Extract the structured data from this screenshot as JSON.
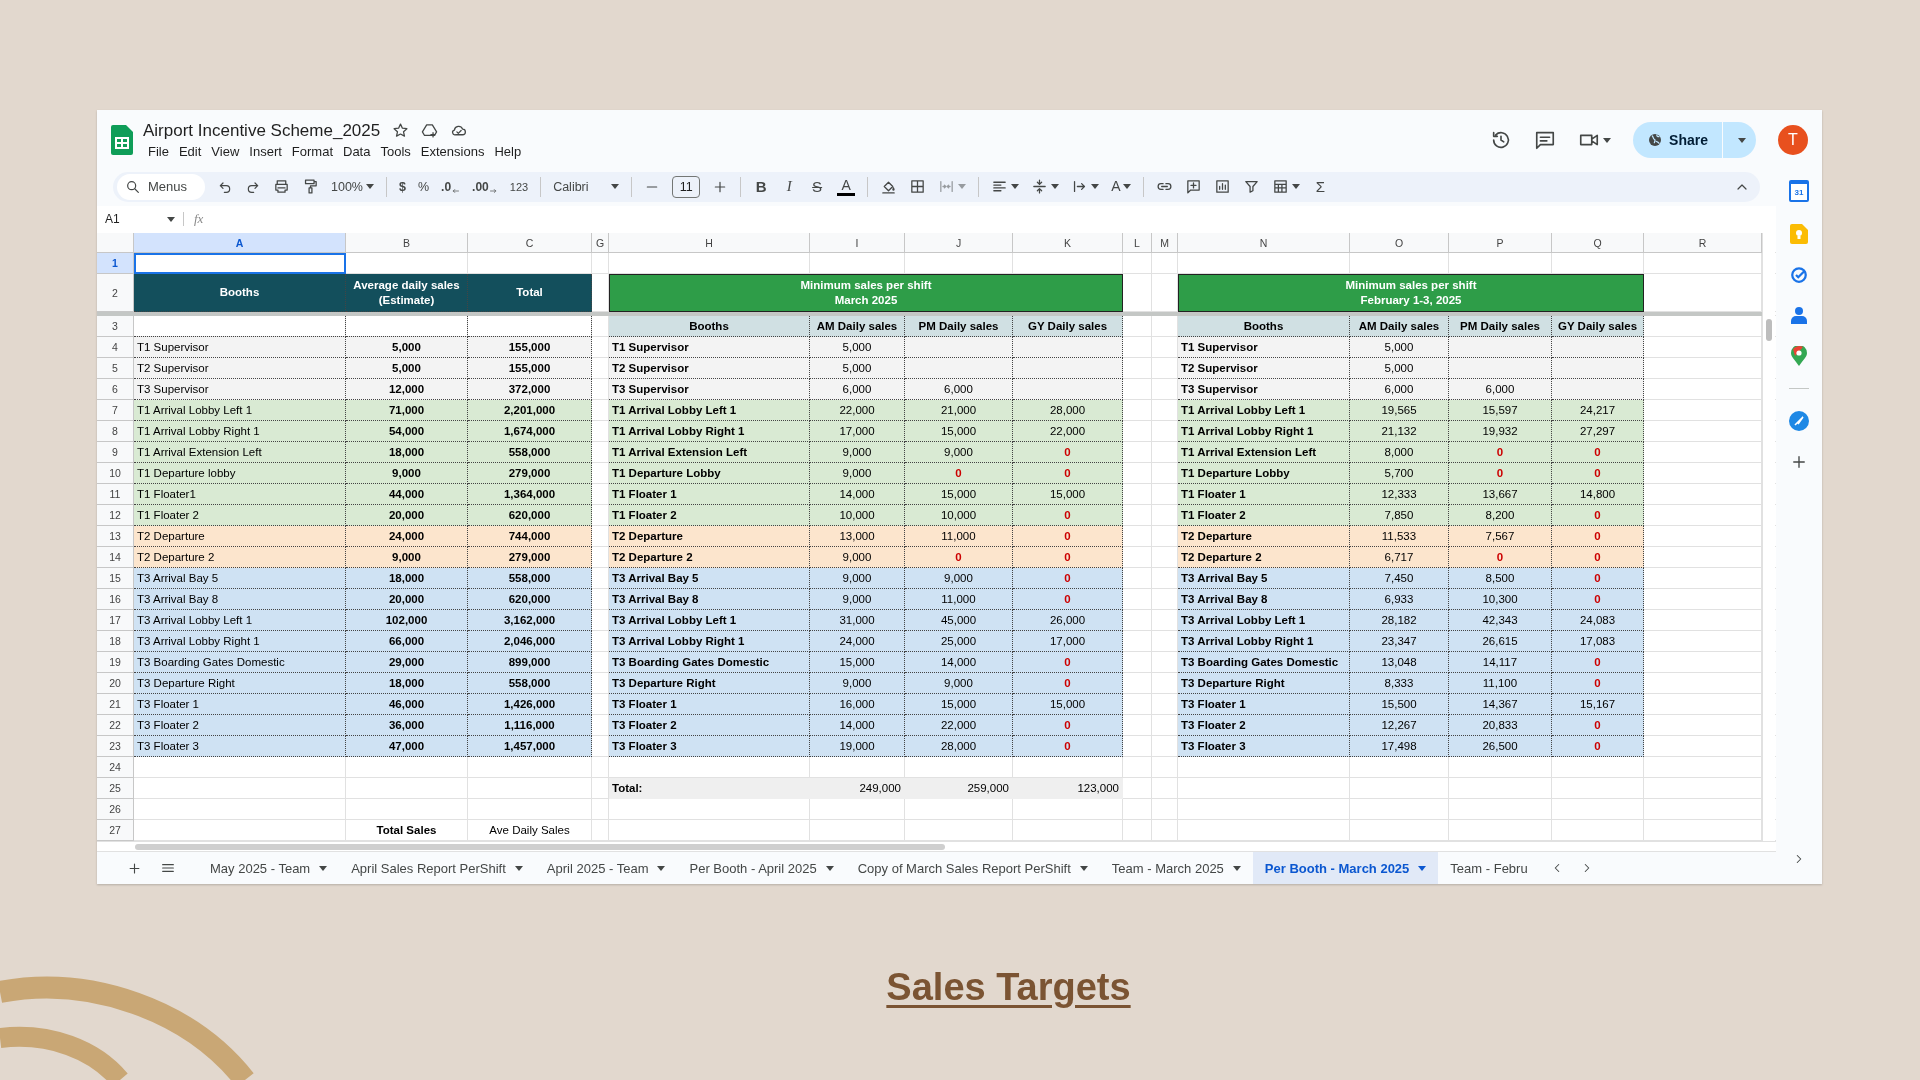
{
  "document": {
    "title": "Airport Incentive Scheme_2025",
    "menus": [
      "File",
      "Edit",
      "View",
      "Insert",
      "Format",
      "Data",
      "Tools",
      "Extensions",
      "Help"
    ],
    "share_label": "Share",
    "avatar_initial": "T"
  },
  "toolbar": {
    "search_placeholder": "Menus",
    "zoom": "100%",
    "currency": "$",
    "percent": "%",
    "decimal_decrease": ".0",
    "decimal_increase": ".00",
    "number_format": "123",
    "font": "Calibri",
    "font_size": "11",
    "bold": "B",
    "italic": "I",
    "strikethrough": "S",
    "text_color": "A",
    "text_rotation": "A",
    "functions": "Σ"
  },
  "formula_bar": {
    "name_box": "A1",
    "formula_label": "fx"
  },
  "side_panel": {
    "calendar_day": "31"
  },
  "sheet": {
    "column_headers": [
      {
        "label": "A",
        "selected": true
      },
      {
        "label": "B",
        "selected": false
      },
      {
        "label": "C",
        "selected": false
      },
      {
        "label": "G",
        "selected": false
      },
      {
        "label": "H",
        "selected": false
      },
      {
        "label": "I",
        "selected": false
      },
      {
        "label": "J",
        "selected": false
      },
      {
        "label": "K",
        "selected": false
      },
      {
        "label": "L",
        "selected": false
      },
      {
        "label": "M",
        "selected": false
      },
      {
        "label": "N",
        "selected": false
      },
      {
        "label": "O",
        "selected": false
      },
      {
        "label": "P",
        "selected": false
      },
      {
        "label": "Q",
        "selected": false
      },
      {
        "label": "R",
        "selected": false
      }
    ],
    "row_numbers": [
      {
        "label": "1",
        "selected": true
      },
      {
        "label": "2",
        "selected": false
      },
      {
        "label": "3",
        "selected": false
      },
      {
        "label": "4",
        "selected": false
      },
      {
        "label": "5",
        "selected": false
      },
      {
        "label": "6",
        "selected": false
      },
      {
        "label": "7",
        "selected": false
      },
      {
        "label": "8",
        "selected": false
      },
      {
        "label": "9",
        "selected": false
      },
      {
        "label": "10",
        "selected": false
      },
      {
        "label": "11",
        "selected": false
      },
      {
        "label": "12",
        "selected": false
      },
      {
        "label": "13",
        "selected": false
      },
      {
        "label": "14",
        "selected": false
      },
      {
        "label": "15",
        "selected": false
      },
      {
        "label": "16",
        "selected": false
      },
      {
        "label": "17",
        "selected": false
      },
      {
        "label": "18",
        "selected": false
      },
      {
        "label": "19",
        "selected": false
      },
      {
        "label": "20",
        "selected": false
      },
      {
        "label": "21",
        "selected": false
      },
      {
        "label": "22",
        "selected": false
      },
      {
        "label": "23",
        "selected": false
      },
      {
        "label": "24",
        "selected": false
      },
      {
        "label": "25",
        "selected": false
      },
      {
        "label": "26",
        "selected": false
      },
      {
        "label": "27",
        "selected": false
      }
    ],
    "booth_table": {
      "headers": [
        [
          "Booths"
        ],
        [
          "Average daily sales",
          "(Estimate)"
        ],
        [
          "Total"
        ]
      ],
      "rows": [
        {
          "booth": "T1 Supervisor",
          "average": "5,000",
          "total": "155,000",
          "color": "#f3f3f3"
        },
        {
          "booth": "T2 Supervisor",
          "average": "5,000",
          "total": "155,000",
          "color": "#f3f3f3"
        },
        {
          "booth": "T3 Supervisor",
          "average": "12,000",
          "total": "372,000",
          "color": "#f3f3f3"
        },
        {
          "booth": "T1 Arrival Lobby Left 1",
          "average": "71,000",
          "total": "2,201,000",
          "color": "#d9ead3"
        },
        {
          "booth": "T1 Arrival Lobby Right 1",
          "average": "54,000",
          "total": "1,674,000",
          "color": "#d9ead3"
        },
        {
          "booth": "T1 Arrival Extension Left",
          "average": "18,000",
          "total": "558,000",
          "color": "#d9ead3"
        },
        {
          "booth": "T1 Departure lobby",
          "average": "9,000",
          "total": "279,000",
          "color": "#d9ead3"
        },
        {
          "booth": "T1 Floater1",
          "average": "44,000",
          "total": "1,364,000",
          "color": "#d9ead3"
        },
        {
          "booth": "T1 Floater 2",
          "average": "20,000",
          "total": "620,000",
          "color": "#d9ead3"
        },
        {
          "booth": "T2 Departure",
          "average": "24,000",
          "total": "744,000",
          "color": "#fce5cd"
        },
        {
          "booth": "T2 Departure 2",
          "average": "9,000",
          "total": "279,000",
          "color": "#fce5cd"
        },
        {
          "booth": "T3 Arrival Bay 5",
          "average": "18,000",
          "total": "558,000",
          "color": "#cfe2f3"
        },
        {
          "booth": "T3 Arrival Bay 8",
          "average": "20,000",
          "total": "620,000",
          "color": "#cfe2f3"
        },
        {
          "booth": "T3 Arrival Lobby Left 1",
          "average": "102,000",
          "total": "3,162,000",
          "color": "#cfe2f3"
        },
        {
          "booth": "T3 Arrival Lobby Right 1",
          "average": "66,000",
          "total": "2,046,000",
          "color": "#cfe2f3"
        },
        {
          "booth": "T3 Boarding Gates Domestic",
          "average": "29,000",
          "total": "899,000",
          "color": "#cfe2f3"
        },
        {
          "booth": "T3 Departure Right",
          "average": "18,000",
          "total": "558,000",
          "color": "#cfe2f3"
        },
        {
          "booth": "T3 Floater 1",
          "average": "46,000",
          "total": "1,426,000",
          "color": "#cfe2f3"
        },
        {
          "booth": "T3 Floater 2",
          "average": "36,000",
          "total": "1,116,000",
          "color": "#cfe2f3"
        },
        {
          "booth": "T3 Floater 3",
          "average": "47,000",
          "total": "1,457,000",
          "color": "#cfe2f3"
        }
      ]
    },
    "shift_tables": [
      {
        "title": [
          "Minimum sales per shift",
          "March 2025"
        ],
        "booth_heading": "Booths",
        "columns": [
          "AM Daily sales",
          "PM Daily sales",
          "GY Daily sales"
        ],
        "rows": [
          {
            "booth": "T1 Supervisor",
            "color": "#f3f3f3",
            "cells": [
              {
                "text": "5,000",
                "flagged": false
              },
              {
                "empty": true
              },
              {
                "empty": true
              }
            ]
          },
          {
            "booth": "T2 Supervisor",
            "color": "#f3f3f3",
            "cells": [
              {
                "text": "5,000",
                "flagged": false
              },
              {
                "empty": true
              },
              {
                "empty": true
              }
            ]
          },
          {
            "booth": "T3 Supervisor",
            "color": "#f3f3f3",
            "cells": [
              {
                "text": "6,000",
                "flagged": false
              },
              {
                "text": "6,000",
                "flagged": false
              },
              {
                "empty": true
              }
            ]
          },
          {
            "booth": "T1 Arrival Lobby Left 1",
            "color": "#d9ead3",
            "cells": [
              {
                "text": "22,000",
                "flagged": false
              },
              {
                "text": "21,000",
                "flagged": false
              },
              {
                "text": "28,000",
                "flagged": false
              }
            ]
          },
          {
            "booth": "T1 Arrival Lobby Right 1",
            "color": "#d9ead3",
            "cells": [
              {
                "text": "17,000",
                "flagged": false
              },
              {
                "text": "15,000",
                "flagged": false
              },
              {
                "text": "22,000",
                "flagged": false
              }
            ]
          },
          {
            "booth": "T1 Arrival Extension Left",
            "color": "#d9ead3",
            "cells": [
              {
                "text": "9,000",
                "flagged": false
              },
              {
                "text": "9,000",
                "flagged": false
              },
              {
                "text": "0",
                "flagged": true
              }
            ]
          },
          {
            "booth": "T1 Departure Lobby",
            "color": "#d9ead3",
            "cells": [
              {
                "text": "9,000",
                "flagged": false
              },
              {
                "text": "0",
                "flagged": true
              },
              {
                "text": "0",
                "flagged": true
              }
            ]
          },
          {
            "booth": "T1 Floater 1",
            "color": "#d9ead3",
            "cells": [
              {
                "text": "14,000",
                "flagged": false
              },
              {
                "text": "15,000",
                "flagged": false
              },
              {
                "text": "15,000",
                "flagged": false
              }
            ]
          },
          {
            "booth": "T1 Floater 2",
            "color": "#d9ead3",
            "cells": [
              {
                "text": "10,000",
                "flagged": false
              },
              {
                "text": "10,000",
                "flagged": false
              },
              {
                "text": "0",
                "flagged": true
              }
            ]
          },
          {
            "booth": "T2 Departure",
            "color": "#fce5cd",
            "cells": [
              {
                "text": "13,000",
                "flagged": false
              },
              {
                "text": "11,000",
                "flagged": false
              },
              {
                "text": "0",
                "flagged": true
              }
            ]
          },
          {
            "booth": "T2 Departure 2",
            "color": "#fce5cd",
            "cells": [
              {
                "text": "9,000",
                "flagged": false
              },
              {
                "text": "0",
                "flagged": true
              },
              {
                "text": "0",
                "flagged": true
              }
            ]
          },
          {
            "booth": "T3 Arrival Bay 5",
            "color": "#cfe2f3",
            "cells": [
              {
                "text": "9,000",
                "flagged": false
              },
              {
                "text": "9,000",
                "flagged": false
              },
              {
                "text": "0",
                "flagged": true
              }
            ]
          },
          {
            "booth": "T3 Arrival Bay 8",
            "color": "#cfe2f3",
            "cells": [
              {
                "text": "9,000",
                "flagged": false
              },
              {
                "text": "11,000",
                "flagged": false
              },
              {
                "text": "0",
                "flagged": true
              }
            ]
          },
          {
            "booth": "T3 Arrival Lobby Left 1",
            "color": "#cfe2f3",
            "cells": [
              {
                "text": "31,000",
                "flagged": false
              },
              {
                "text": "45,000",
                "flagged": false
              },
              {
                "text": "26,000",
                "flagged": false
              }
            ]
          },
          {
            "booth": "T3 Arrival Lobby Right 1",
            "color": "#cfe2f3",
            "cells": [
              {
                "text": "24,000",
                "flagged": false
              },
              {
                "text": "25,000",
                "flagged": false
              },
              {
                "text": "17,000",
                "flagged": false
              }
            ]
          },
          {
            "booth": "T3 Boarding Gates Domestic",
            "color": "#cfe2f3",
            "cells": [
              {
                "text": "15,000",
                "flagged": false
              },
              {
                "text": "14,000",
                "flagged": false
              },
              {
                "text": "0",
                "flagged": true
              }
            ]
          },
          {
            "booth": "T3 Departure Right",
            "color": "#cfe2f3",
            "cells": [
              {
                "text": "9,000",
                "flagged": false
              },
              {
                "text": "9,000",
                "flagged": false
              },
              {
                "text": "0",
                "flagged": true
              }
            ]
          },
          {
            "booth": "T3 Floater 1",
            "color": "#cfe2f3",
            "cells": [
              {
                "text": "16,000",
                "flagged": false
              },
              {
                "text": "15,000",
                "flagged": false
              },
              {
                "text": "15,000",
                "flagged": false
              }
            ]
          },
          {
            "booth": "T3 Floater 2",
            "color": "#cfe2f3",
            "cells": [
              {
                "text": "14,000",
                "flagged": false
              },
              {
                "text": "22,000",
                "flagged": false
              },
              {
                "text": "0",
                "flagged": true
              }
            ]
          },
          {
            "booth": "T3 Floater 3",
            "color": "#cfe2f3",
            "cells": [
              {
                "text": "19,000",
                "flagged": false
              },
              {
                "text": "28,000",
                "flagged": false
              },
              {
                "text": "0",
                "flagged": true
              }
            ]
          }
        ],
        "totals": {
          "label": "Total:",
          "values": [
            "249,000",
            "259,000",
            "123,000"
          ]
        }
      },
      {
        "title": [
          "Minimum sales per shift",
          "February 1-3, 2025"
        ],
        "booth_heading": "Booths",
        "columns": [
          "AM Daily sales",
          "PM Daily sales",
          "GY Daily sales"
        ],
        "rows": [
          {
            "booth": "T1 Supervisor",
            "color": "#f3f3f3",
            "cells": [
              {
                "text": "5,000",
                "flagged": false
              },
              {
                "empty": true
              },
              {
                "empty": true
              }
            ]
          },
          {
            "booth": "T2 Supervisor",
            "color": "#f3f3f3",
            "cells": [
              {
                "text": "5,000",
                "flagged": false
              },
              {
                "empty": true
              },
              {
                "empty": true
              }
            ]
          },
          {
            "booth": "T3 Supervisor",
            "color": "#f3f3f3",
            "cells": [
              {
                "text": "6,000",
                "flagged": false
              },
              {
                "text": "6,000",
                "flagged": false
              },
              {
                "empty": true
              }
            ]
          },
          {
            "booth": "T1 Arrival Lobby Left 1",
            "color": "#d9ead3",
            "cells": [
              {
                "text": "19,565",
                "flagged": false
              },
              {
                "text": "15,597",
                "flagged": false
              },
              {
                "text": "24,217",
                "flagged": false
              }
            ]
          },
          {
            "booth": "T1 Arrival Lobby Right 1",
            "color": "#d9ead3",
            "cells": [
              {
                "text": "21,132",
                "flagged": false
              },
              {
                "text": "19,932",
                "flagged": false
              },
              {
                "text": "27,297",
                "flagged": false
              }
            ]
          },
          {
            "booth": "T1 Arrival Extension Left",
            "color": "#d9ead3",
            "cells": [
              {
                "text": "8,000",
                "flagged": false
              },
              {
                "text": "0",
                "flagged": true
              },
              {
                "text": "0",
                "flagged": true
              }
            ]
          },
          {
            "booth": "T1 Departure Lobby",
            "color": "#d9ead3",
            "cells": [
              {
                "text": "5,700",
                "flagged": false
              },
              {
                "text": "0",
                "flagged": true
              },
              {
                "text": "0",
                "flagged": true
              }
            ]
          },
          {
            "booth": "T1 Floater 1",
            "color": "#d9ead3",
            "cells": [
              {
                "text": "12,333",
                "flagged": false
              },
              {
                "text": "13,667",
                "flagged": false
              },
              {
                "text": "14,800",
                "flagged": false
              }
            ]
          },
          {
            "booth": "T1 Floater 2",
            "color": "#d9ead3",
            "cells": [
              {
                "text": "7,850",
                "flagged": false
              },
              {
                "text": "8,200",
                "flagged": false
              },
              {
                "text": "0",
                "flagged": true
              }
            ]
          },
          {
            "booth": "T2 Departure",
            "color": "#fce5cd",
            "cells": [
              {
                "text": "11,533",
                "flagged": false
              },
              {
                "text": "7,567",
                "flagged": false
              },
              {
                "text": "0",
                "flagged": true
              }
            ]
          },
          {
            "booth": "T2 Departure 2",
            "color": "#fce5cd",
            "cells": [
              {
                "text": "6,717",
                "flagged": false
              },
              {
                "text": "0",
                "flagged": true
              },
              {
                "text": "0",
                "flagged": true
              }
            ]
          },
          {
            "booth": "T3 Arrival Bay 5",
            "color": "#cfe2f3",
            "cells": [
              {
                "text": "7,450",
                "flagged": false
              },
              {
                "text": "8,500",
                "flagged": false
              },
              {
                "text": "0",
                "flagged": true
              }
            ]
          },
          {
            "booth": "T3 Arrival Bay 8",
            "color": "#cfe2f3",
            "cells": [
              {
                "text": "6,933",
                "flagged": false
              },
              {
                "text": "10,300",
                "flagged": false
              },
              {
                "text": "0",
                "flagged": true
              }
            ]
          },
          {
            "booth": "T3 Arrival Lobby Left 1",
            "color": "#cfe2f3",
            "cells": [
              {
                "text": "28,182",
                "flagged": false
              },
              {
                "text": "42,343",
                "flagged": false
              },
              {
                "text": "24,083",
                "flagged": false
              }
            ]
          },
          {
            "booth": "T3 Arrival Lobby Right 1",
            "color": "#cfe2f3",
            "cells": [
              {
                "text": "23,347",
                "flagged": false
              },
              {
                "text": "26,615",
                "flagged": false
              },
              {
                "text": "17,083",
                "flagged": false
              }
            ]
          },
          {
            "booth": "T3 Boarding Gates Domestic",
            "color": "#cfe2f3",
            "cells": [
              {
                "text": "13,048",
                "flagged": false
              },
              {
                "text": "14,117",
                "flagged": false
              },
              {
                "text": "0",
                "flagged": true
              }
            ]
          },
          {
            "booth": "T3 Departure Right",
            "color": "#cfe2f3",
            "cells": [
              {
                "text": "8,333",
                "flagged": false
              },
              {
                "text": "11,100",
                "flagged": false
              },
              {
                "text": "0",
                "flagged": true
              }
            ]
          },
          {
            "booth": "T3 Floater 1",
            "color": "#cfe2f3",
            "cells": [
              {
                "text": "15,500",
                "flagged": false
              },
              {
                "text": "14,367",
                "flagged": false
              },
              {
                "text": "15,167",
                "flagged": false
              }
            ]
          },
          {
            "booth": "T3 Floater 2",
            "color": "#cfe2f3",
            "cells": [
              {
                "text": "12,267",
                "flagged": false
              },
              {
                "text": "20,833",
                "flagged": false
              },
              {
                "text": "0",
                "flagged": true
              }
            ]
          },
          {
            "booth": "T3 Floater 3",
            "color": "#cfe2f3",
            "cells": [
              {
                "text": "17,498",
                "flagged": false
              },
              {
                "text": "26,500",
                "flagged": false
              },
              {
                "text": "0",
                "flagged": true
              }
            ]
          }
        ]
      }
    ],
    "footer_labels": [
      "Total Sales",
      "Ave Daily Sales"
    ]
  },
  "tabs": [
    {
      "label": "May 2025 - Team",
      "selected": false
    },
    {
      "label": "April Sales Report PerShift",
      "selected": false
    },
    {
      "label": "April 2025 - Team",
      "selected": false
    },
    {
      "label": "Per Booth - April 2025",
      "selected": false
    },
    {
      "label": "Copy of March Sales Report PerShift",
      "selected": false
    },
    {
      "label": "Team - March 2025",
      "selected": false
    },
    {
      "label": "Per Booth - March 2025",
      "selected": true
    },
    {
      "label": "Team - Febru",
      "selected": false
    }
  ],
  "slide_title": "Sales Targets"
}
